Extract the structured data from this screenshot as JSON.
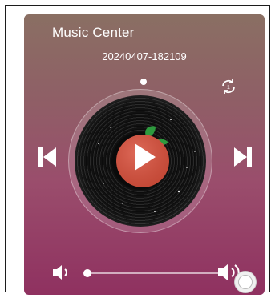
{
  "player": {
    "title": "Music Center",
    "track_name": "20240407-182109",
    "playback_progress": 0.0,
    "volume_level": 0.0
  },
  "icons": {
    "loop": "repeat-icon",
    "previous": "skip-previous-icon",
    "play": "play-icon",
    "next": "skip-next-icon",
    "volume_down": "volume-down-icon",
    "volume_up": "volume-up-icon",
    "album_art": "tomato-fruit-icon"
  },
  "colors": {
    "accent": "#d9503c",
    "leaf": "#2e9a3e",
    "text": "#ffffff"
  }
}
